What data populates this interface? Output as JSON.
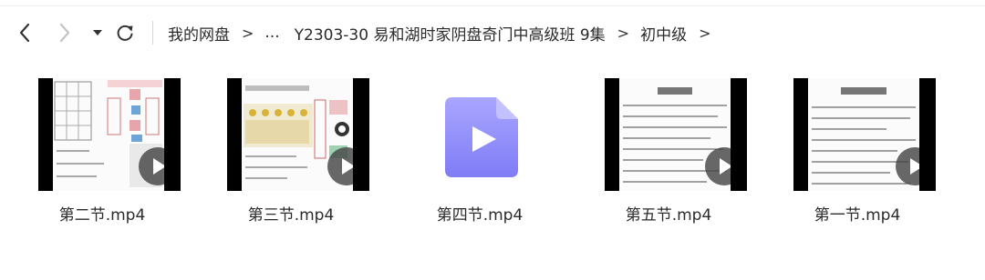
{
  "toolbar": {
    "back_icon": "arrow-left-icon",
    "forward_icon": "arrow-right-icon",
    "history_icon": "caret-down-icon",
    "refresh_icon": "refresh-icon",
    "breadcrumb": {
      "root": "我的网盘",
      "ellipsis": "...",
      "folder": "Y2303-30 易和湖时家阴盘奇门中高级班 9集",
      "current": "初中级",
      "separator": ">"
    }
  },
  "files": [
    {
      "name": "第二节.mp4"
    },
    {
      "name": "第三节.mp4"
    },
    {
      "name": "第四节.mp4"
    },
    {
      "name": "第五节.mp4"
    },
    {
      "name": "第一节.mp4"
    }
  ],
  "colors": {
    "video_icon_top": "#a9a6ff",
    "video_icon_bottom": "#7f7cf6",
    "play_badge": "#4a4a4a"
  }
}
